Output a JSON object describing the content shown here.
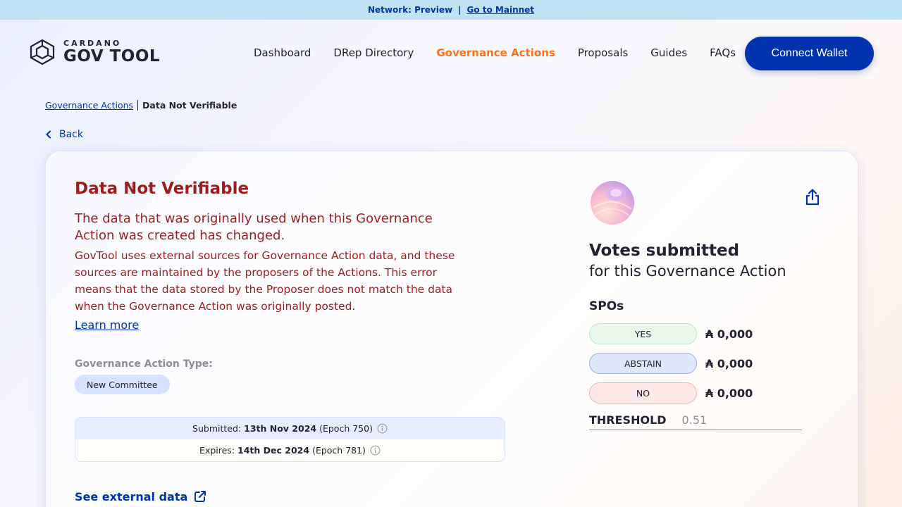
{
  "network": {
    "label": "Network: Preview",
    "separator": "|",
    "link": "Go to Mainnet"
  },
  "logo": {
    "small": "CARDANO",
    "big": "GOV TOOL"
  },
  "nav": {
    "items": [
      "Dashboard",
      "DRep Directory",
      "Governance Actions",
      "Proposals",
      "Guides",
      "FAQs"
    ],
    "active": "Governance Actions",
    "connect": "Connect Wallet"
  },
  "breadcrumb": {
    "parent": "Governance Actions",
    "current": "Data Not Verifiable"
  },
  "back": "Back",
  "error": {
    "title": "Data Not Verifiable",
    "subtitle": "The data that was originally used when this Governance Action was created has changed.",
    "body": "GovTool uses external sources for Governance Action data, and these sources are maintained by the proposers of the Actions. This error means that the data stored by the Proposer does not match the data when the Governance Action was originally posted.",
    "learn_more": "Learn more"
  },
  "action_type": {
    "label": "Governance Action Type:",
    "value": "New Committee"
  },
  "dates": {
    "submitted_label": "Submitted:",
    "submitted_date": "13th Nov 2024",
    "submitted_epoch": "(Epoch 750)",
    "expires_label": "Expires:",
    "expires_date": "14th Dec 2024",
    "expires_epoch": "(Epoch 781)"
  },
  "external_link": "See external data",
  "votes": {
    "title": "Votes submitted",
    "subtitle": "for this Governance Action",
    "group": "SPOs",
    "rows": [
      {
        "label": "YES",
        "amount": "₳ 0,000"
      },
      {
        "label": "ABSTAIN",
        "amount": "₳ 0,000"
      },
      {
        "label": "NO",
        "amount": "₳ 0,000"
      }
    ],
    "threshold_label": "THRESHOLD",
    "threshold_value": "0.51"
  },
  "colors": {
    "brand_blue": "#0033ad",
    "active_nav": "#f97316",
    "error_red": "#9e1c1c",
    "topbar_bg": "#bfe3f2"
  },
  "icons": [
    "cardano-gov-tool-logo-icon",
    "chevron-left-icon",
    "info-icon",
    "external-link-icon",
    "share-icon",
    "drep-avatar-icon"
  ]
}
